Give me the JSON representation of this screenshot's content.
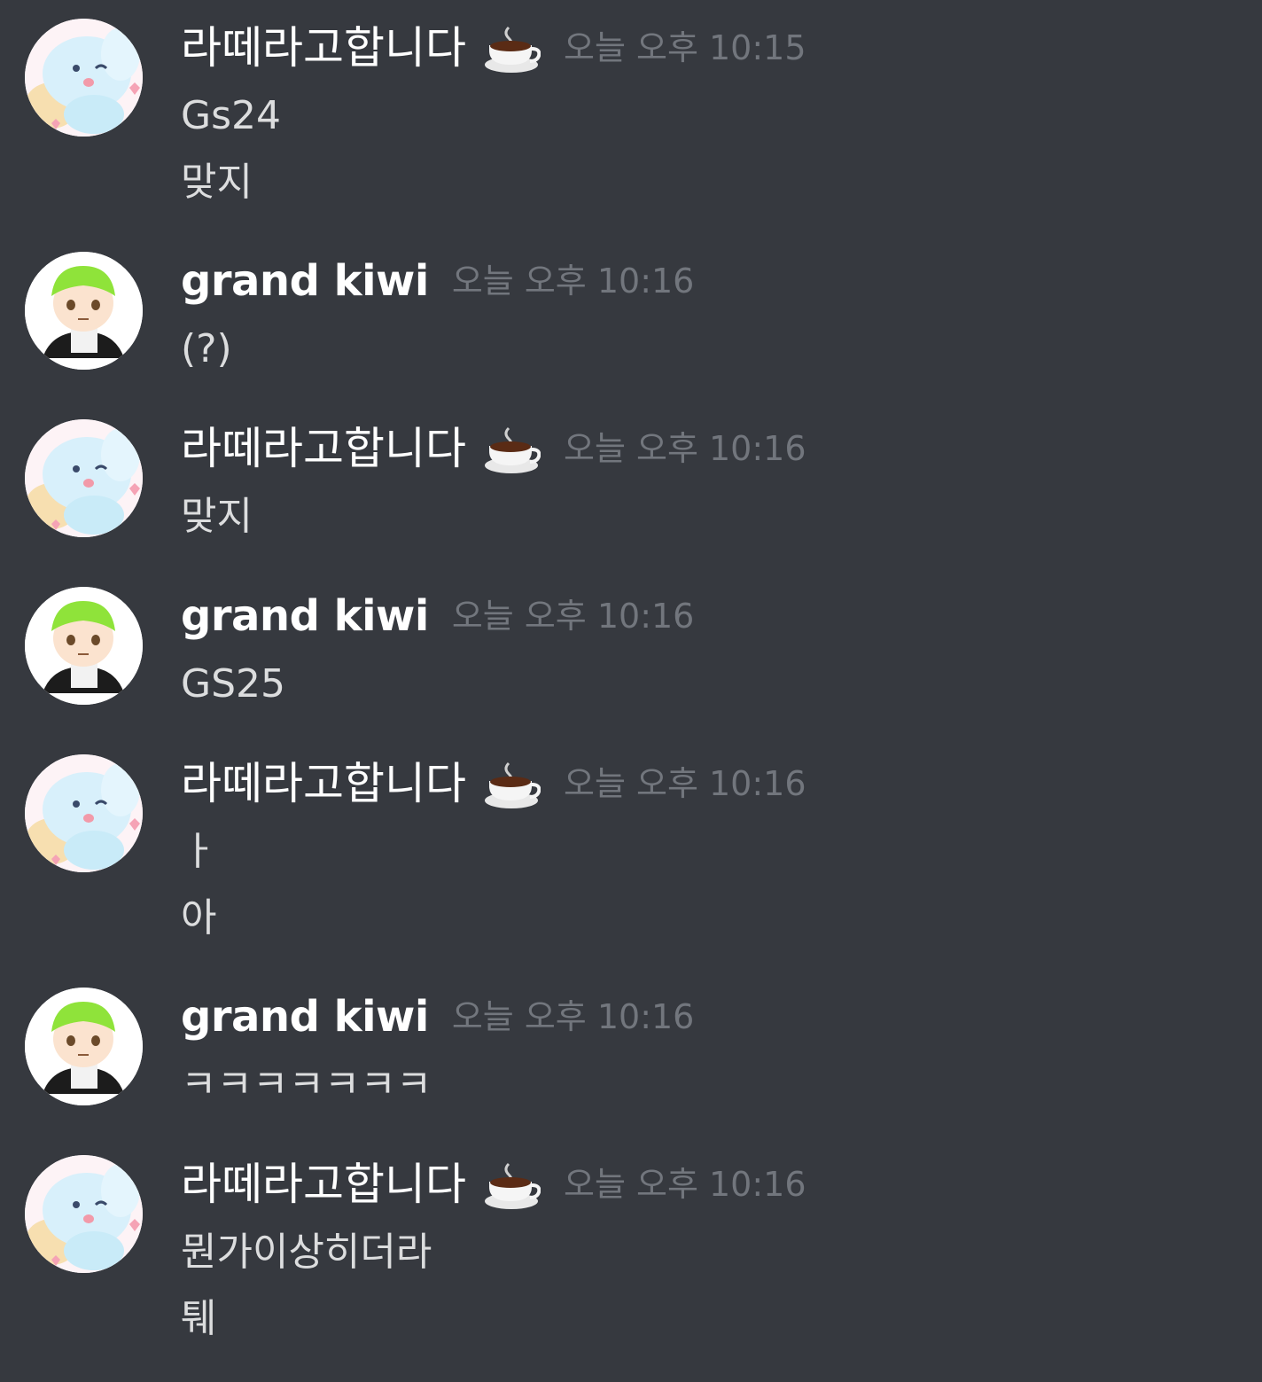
{
  "users": {
    "latte": {
      "name": "라떼라고합니다",
      "badge_icon": "coffee-cup-icon"
    },
    "kiwi": {
      "name": "grand kiwi"
    }
  },
  "messages": [
    {
      "author": "라떼라고합니다",
      "time": "오늘 오후 10:15",
      "lines": [
        "Gs24",
        "맞지"
      ]
    },
    {
      "author": "grand kiwi",
      "time": "오늘 오후 10:16",
      "lines": [
        "(?)"
      ]
    },
    {
      "author": "라떼라고합니다",
      "time": "오늘 오후 10:16",
      "lines": [
        "맞지"
      ]
    },
    {
      "author": "grand kiwi",
      "time": "오늘 오후 10:16",
      "lines": [
        "GS25"
      ]
    },
    {
      "author": "라떼라고합니다",
      "time": "오늘 오후 10:16",
      "lines": [
        "ㅏ",
        "아"
      ]
    },
    {
      "author": "grand kiwi",
      "time": "오늘 오후 10:16",
      "lines": [
        "ㅋㅋㅋㅋㅋㅋㅋ"
      ]
    },
    {
      "author": "라떼라고합니다",
      "time": "오늘 오후 10:16",
      "lines": [
        "뭔가이상히더라",
        "퉤"
      ]
    }
  ],
  "colors": {
    "background": "#36393f",
    "username": "#ffffff",
    "timestamp": "#72767d",
    "message_text": "#dcddde"
  }
}
